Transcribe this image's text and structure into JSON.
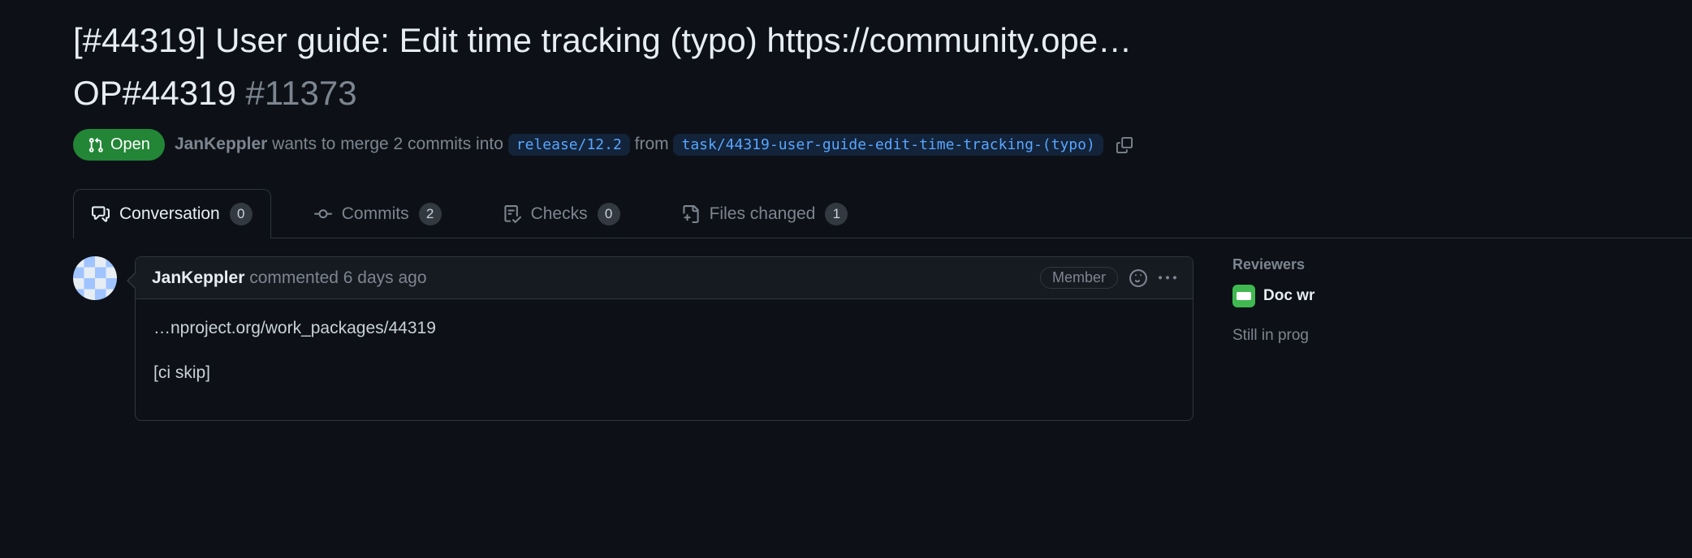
{
  "title_line1": "[#44319] User guide: Edit time tracking (typo) https://community.ope…",
  "title_line2_ref": "OP#44319",
  "pr_number": "#11373",
  "state": "Open",
  "merge_line": {
    "author": "JanKeppler",
    "text1": " wants to merge 2 commits into ",
    "base_branch": "release/12.2",
    "text2": " from ",
    "head_branch": "task/44319-user-guide-edit-time-tracking-(typo)"
  },
  "tabs": {
    "conversation": {
      "label": "Conversation",
      "count": "0"
    },
    "commits": {
      "label": "Commits",
      "count": "2"
    },
    "checks": {
      "label": "Checks",
      "count": "0"
    },
    "files": {
      "label": "Files changed",
      "count": "1"
    }
  },
  "comment": {
    "author": "JanKeppler",
    "action": " commented ",
    "time": "6 days ago",
    "role": "Member",
    "body_line1": "…nproject.org/work_packages/44319",
    "body_line2": "[ci skip]"
  },
  "sidebar": {
    "reviewers_heading": "Reviewers",
    "reviewer_name": "Doc wr",
    "status_text": "Still in prog"
  }
}
